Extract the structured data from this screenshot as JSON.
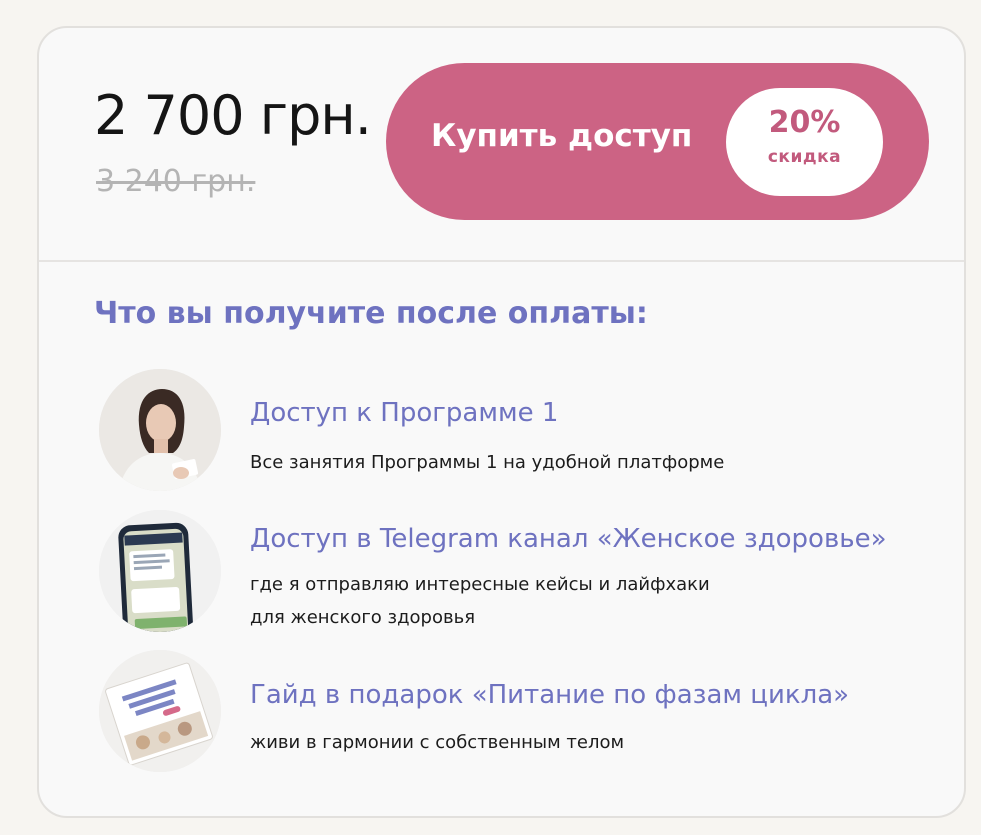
{
  "pricing": {
    "price": "2 700 грн.",
    "old_price": "3 240 грн."
  },
  "buy_button": {
    "label": "Купить доступ",
    "discount_percent": "20%",
    "discount_label": "скидка"
  },
  "colors": {
    "accent": "#cc6384",
    "heading": "#6e72c0",
    "discount_text": "#c25a7d"
  },
  "benefits": {
    "heading": "Что вы получите после оплаты:",
    "items": [
      {
        "icon": "woman-portrait-image",
        "title": "Доступ к Программе 1",
        "desc_lines": [
          "Все занятия Программы 1 на удобной платформе"
        ]
      },
      {
        "icon": "phone-telegram-image",
        "title": "Доступ в Telegram канал «Женское здоровье»",
        "desc_lines": [
          "где я отправляю интересные кейсы и лайфхаки",
          "для женского здоровья"
        ]
      },
      {
        "icon": "guide-book-image",
        "title": "Гайд в подарок «Питание по фазам цикла»",
        "desc_lines": [
          "живи в гармонии с собственным телом"
        ]
      }
    ]
  }
}
